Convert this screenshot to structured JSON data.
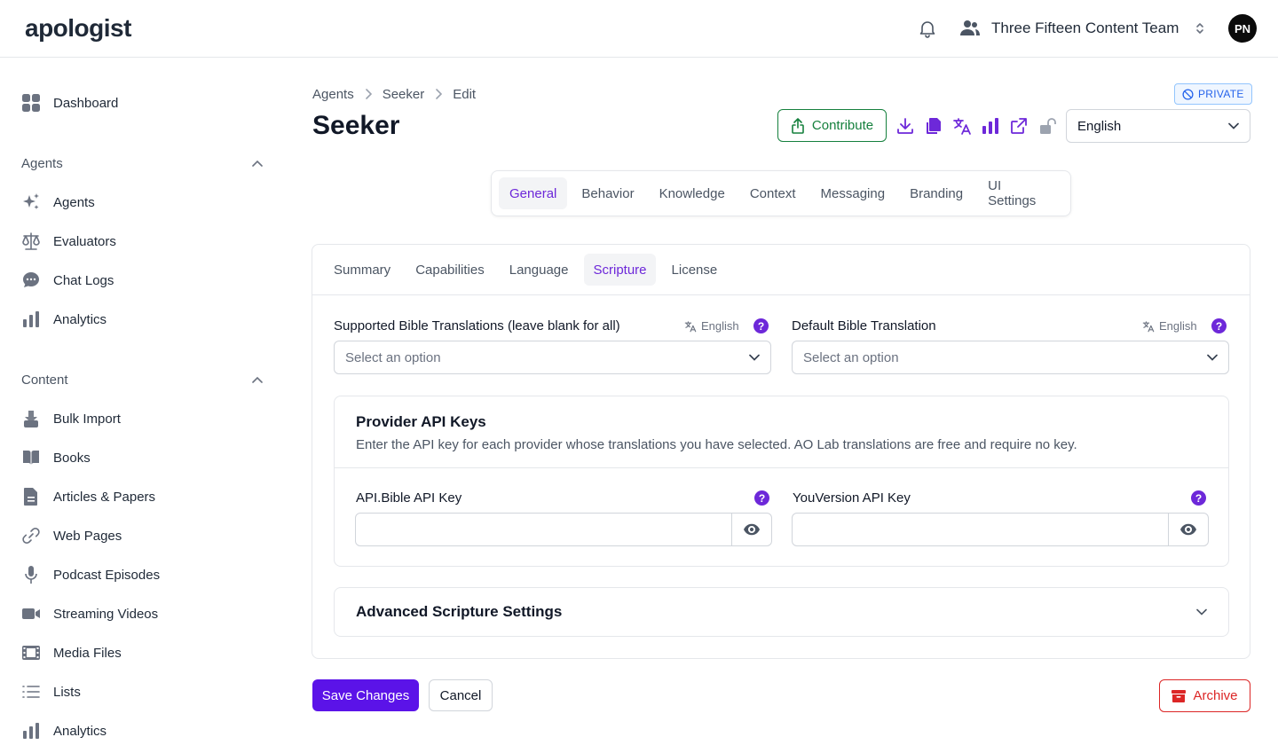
{
  "header": {
    "logo_text": "apologist",
    "team_name": "Three Fifteen Content Team",
    "avatar_initials": "PN",
    "accent_color": "#7c3aed"
  },
  "sidebar": {
    "dashboard": "Dashboard",
    "sections": [
      {
        "title": "Agents",
        "items": [
          {
            "label": "Agents",
            "icon": "sparkles-icon"
          },
          {
            "label": "Evaluators",
            "icon": "scale-icon"
          },
          {
            "label": "Chat Logs",
            "icon": "chat-bubble-icon"
          },
          {
            "label": "Analytics",
            "icon": "bar-chart-icon"
          }
        ]
      },
      {
        "title": "Content",
        "items": [
          {
            "label": "Bulk Import",
            "icon": "import-icon"
          },
          {
            "label": "Books",
            "icon": "book-icon"
          },
          {
            "label": "Articles & Papers",
            "icon": "document-icon"
          },
          {
            "label": "Web Pages",
            "icon": "link-icon"
          },
          {
            "label": "Podcast Episodes",
            "icon": "microphone-icon"
          },
          {
            "label": "Streaming Videos",
            "icon": "video-icon"
          },
          {
            "label": "Media Files",
            "icon": "film-icon"
          },
          {
            "label": "Lists",
            "icon": "list-icon"
          },
          {
            "label": "Analytics",
            "icon": "bar-chart-icon"
          }
        ]
      }
    ]
  },
  "breadcrumb": [
    "Agents",
    "Seeker",
    "Edit"
  ],
  "visibility_badge": "PRIVATE",
  "page_title": "Seeker",
  "toolbar": {
    "contribute_label": "Contribute",
    "language_value": "English"
  },
  "main_tabs": [
    "General",
    "Behavior",
    "Knowledge",
    "Context",
    "Messaging",
    "Branding",
    "UI Settings"
  ],
  "sub_tabs": [
    "Summary",
    "Capabilities",
    "Language",
    "Scripture",
    "License"
  ],
  "scripture": {
    "supported_label": "Supported Bible Translations (leave blank for all)",
    "supported_lang": "English",
    "supported_placeholder": "Select an option",
    "default_label": "Default Bible Translation",
    "default_lang": "English",
    "default_placeholder": "Select an option",
    "help_glyph": "?"
  },
  "provider_keys": {
    "title": "Provider API Keys",
    "description": "Enter the API key for each provider whose translations you have selected. AO Lab translations are free and require no key.",
    "api_bible_label": "API.Bible API Key",
    "api_bible_value": "",
    "youversion_label": "YouVersion API Key",
    "youversion_value": ""
  },
  "advanced": {
    "title": "Advanced Scripture Settings"
  },
  "footer": {
    "save_label": "Save Changes",
    "cancel_label": "Cancel",
    "archive_label": "Archive"
  },
  "colors": {
    "primary": "#5b13e8",
    "active_tab_text": "#6d28d9",
    "contribute_green": "#15803d",
    "archive_red": "#dc2626",
    "private_blue": "#2563eb"
  }
}
